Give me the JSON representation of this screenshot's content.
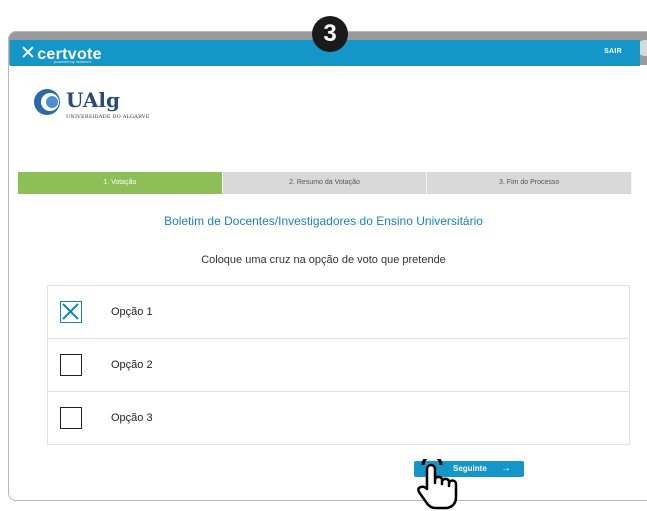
{
  "step_badge": "3",
  "app": {
    "brand": "certvote",
    "brand_tagline": "powered by multicert",
    "logout_label": "SAIR"
  },
  "institution": {
    "name": "UAlg",
    "subtitle": "UNIVERSIDADE DO ALGARVE"
  },
  "steps": [
    {
      "label": "1. Votação",
      "active": true
    },
    {
      "label": "2. Resumo da Votação",
      "active": false
    },
    {
      "label": "3. Fim do Processo",
      "active": false
    }
  ],
  "ballot": {
    "title": "Boletim de Docentes/Investigadores do Ensino Universitário",
    "instruction": "Coloque uma cruz na opção de voto que pretende",
    "options": [
      {
        "label": "Opção 1",
        "checked": true
      },
      {
        "label": "Opção 2",
        "checked": false
      },
      {
        "label": "Opção 3",
        "checked": false
      }
    ]
  },
  "next_button": {
    "label": "Seguinte",
    "icon": "arrow-right-icon"
  },
  "colors": {
    "primary": "#1596c8",
    "active_step": "#8dbf57",
    "title": "#1886b4",
    "step_inactive": "#d9d9d9",
    "window_chrome": "#9a9a9a"
  }
}
